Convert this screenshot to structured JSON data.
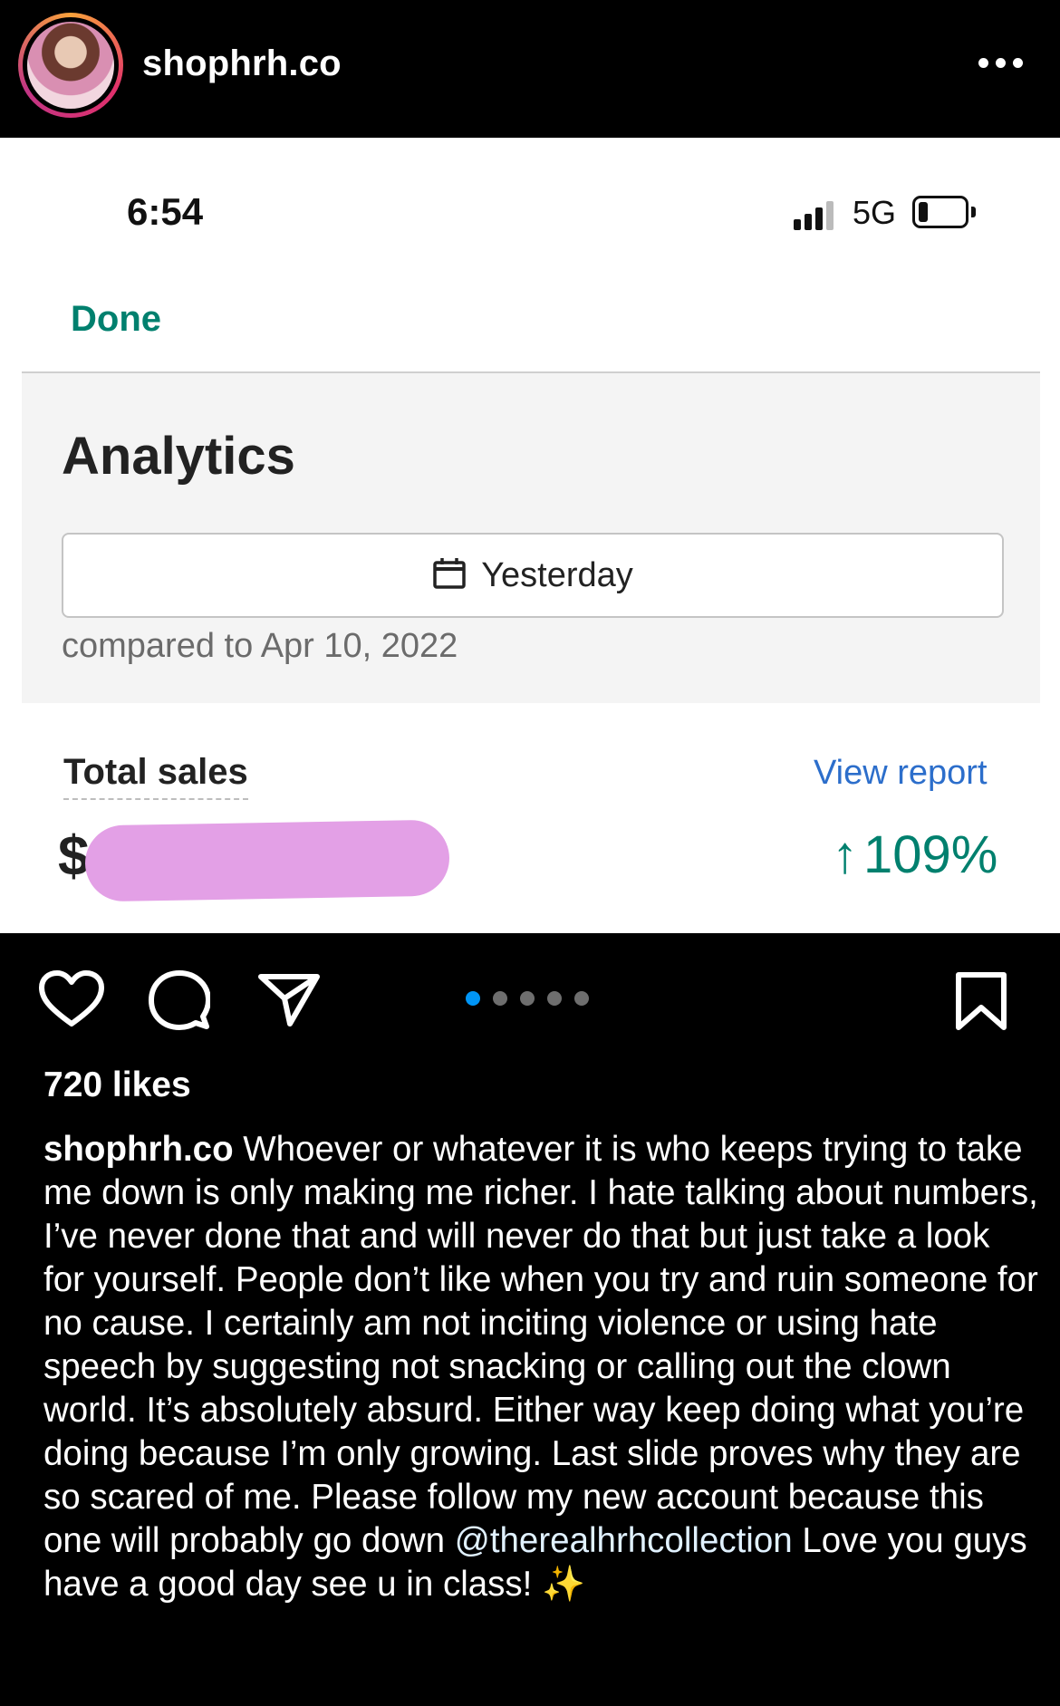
{
  "header": {
    "username": "shophrh.co",
    "avatar_icon": "profile-avatar",
    "more_icon": "more-horizontal-icon"
  },
  "screenshot": {
    "status_time": "6:54",
    "network_label": "5G",
    "done_label": "Done",
    "analytics_title": "Analytics",
    "date_filter_label": "Yesterday",
    "compare_text": "compared to Apr 10, 2022",
    "total_sales_label": "Total sales",
    "view_report_label": "View report",
    "currency_symbol": "$",
    "growth_arrow": "↑",
    "growth_value": "109%",
    "colors": {
      "accent_green": "#00806e",
      "link_blue": "#2c6ecb",
      "redaction": "#e3a0e6"
    }
  },
  "actions": {
    "icons": [
      "heart-icon",
      "comment-icon",
      "share-icon",
      "bookmark-icon"
    ],
    "carousel": {
      "total": 5,
      "active_index": 0,
      "active_color": "#0095f6"
    }
  },
  "likes_text": "720 likes",
  "caption": {
    "username": "shophrh.co",
    "text_part1": " Whoever or whatever it is who keeps trying to take me down is only making me richer. I hate talking about numbers, I’ve never done that and will never do that but just take a look for yourself. People don’t like when you try and ruin someone for no cause. I certainly am not inciting violence or using hate speech by suggesting not snacking or calling out the clown world. It’s absolutely absurd. Either way keep doing what you’re doing because I’m only growing. Last slide proves why they are so scared of me. Please follow my new account because this one will probably go down ",
    "mention": "@therealhrhcollection",
    "text_part2": " Love you guys have a good day see u in class! ",
    "emoji": "✨"
  }
}
